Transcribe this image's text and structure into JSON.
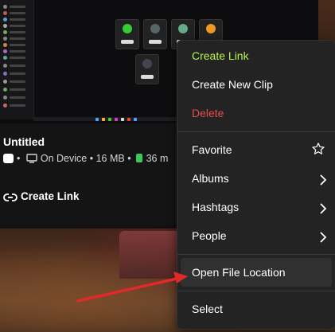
{
  "clip": {
    "title": "Untitled",
    "meta_source": "On Device",
    "meta_size": "16 MB",
    "meta_extra": "36 m",
    "separator": "•",
    "create_link_label": "Create Link"
  },
  "menu": {
    "create_link": "Create Link",
    "create_new_clip": "Create New Clip",
    "delete": "Delete",
    "favorite": "Favorite",
    "albums": "Albums",
    "hashtags": "Hashtags",
    "people": "People",
    "open_file_location": "Open File Location",
    "select": "Select"
  },
  "colors": {
    "accent_green": "#b7f34a",
    "danger_red": "#e54b4b",
    "annotation_arrow": "#e02a2a"
  }
}
